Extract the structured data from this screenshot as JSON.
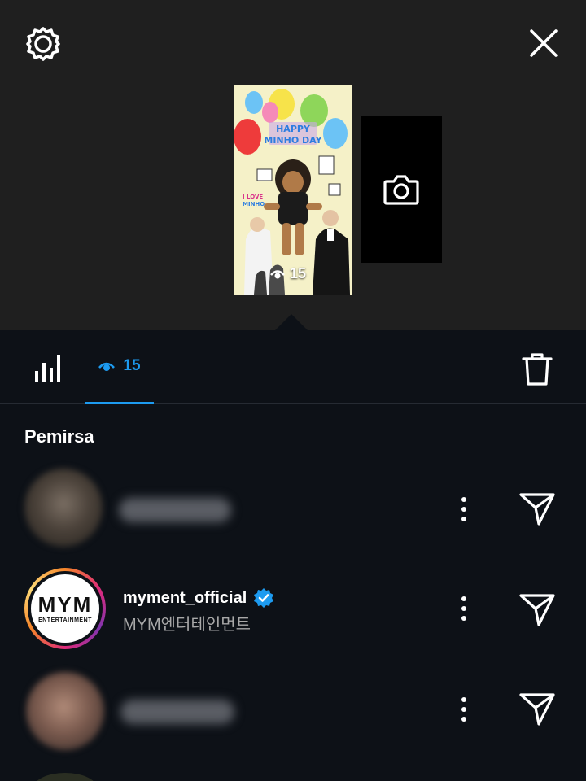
{
  "header": {
    "settings_icon": "gear-icon",
    "close_icon": "close-icon"
  },
  "story": {
    "thumb_title": "HAPPY MINHO DAY",
    "thumb_subtitle": "I LOVE MINHO",
    "view_count": "15",
    "add_story_icon": "camera-icon"
  },
  "tabs": {
    "stats_icon": "bar-chart-icon",
    "views_icon": "eye-icon",
    "views_count": "15",
    "delete_icon": "trash-icon"
  },
  "viewers": {
    "title": "Pemirsa",
    "items": [
      {
        "username": "",
        "fullname": "",
        "blurred": true
      },
      {
        "username": "myment_official",
        "fullname": "MYM엔터테인먼트",
        "verified": true,
        "logo_big": "MYM",
        "logo_small": "ENTERTAINMENT"
      },
      {
        "username": "",
        "fullname": "",
        "blurred": true
      }
    ],
    "more_icon": "more-vertical-icon",
    "send_icon": "send-icon"
  },
  "colors": {
    "accent": "#1d9bf0",
    "top_bg": "#1f1f1f",
    "page_bg": "#0d1117",
    "secondary_text": "#a8a8a8"
  }
}
